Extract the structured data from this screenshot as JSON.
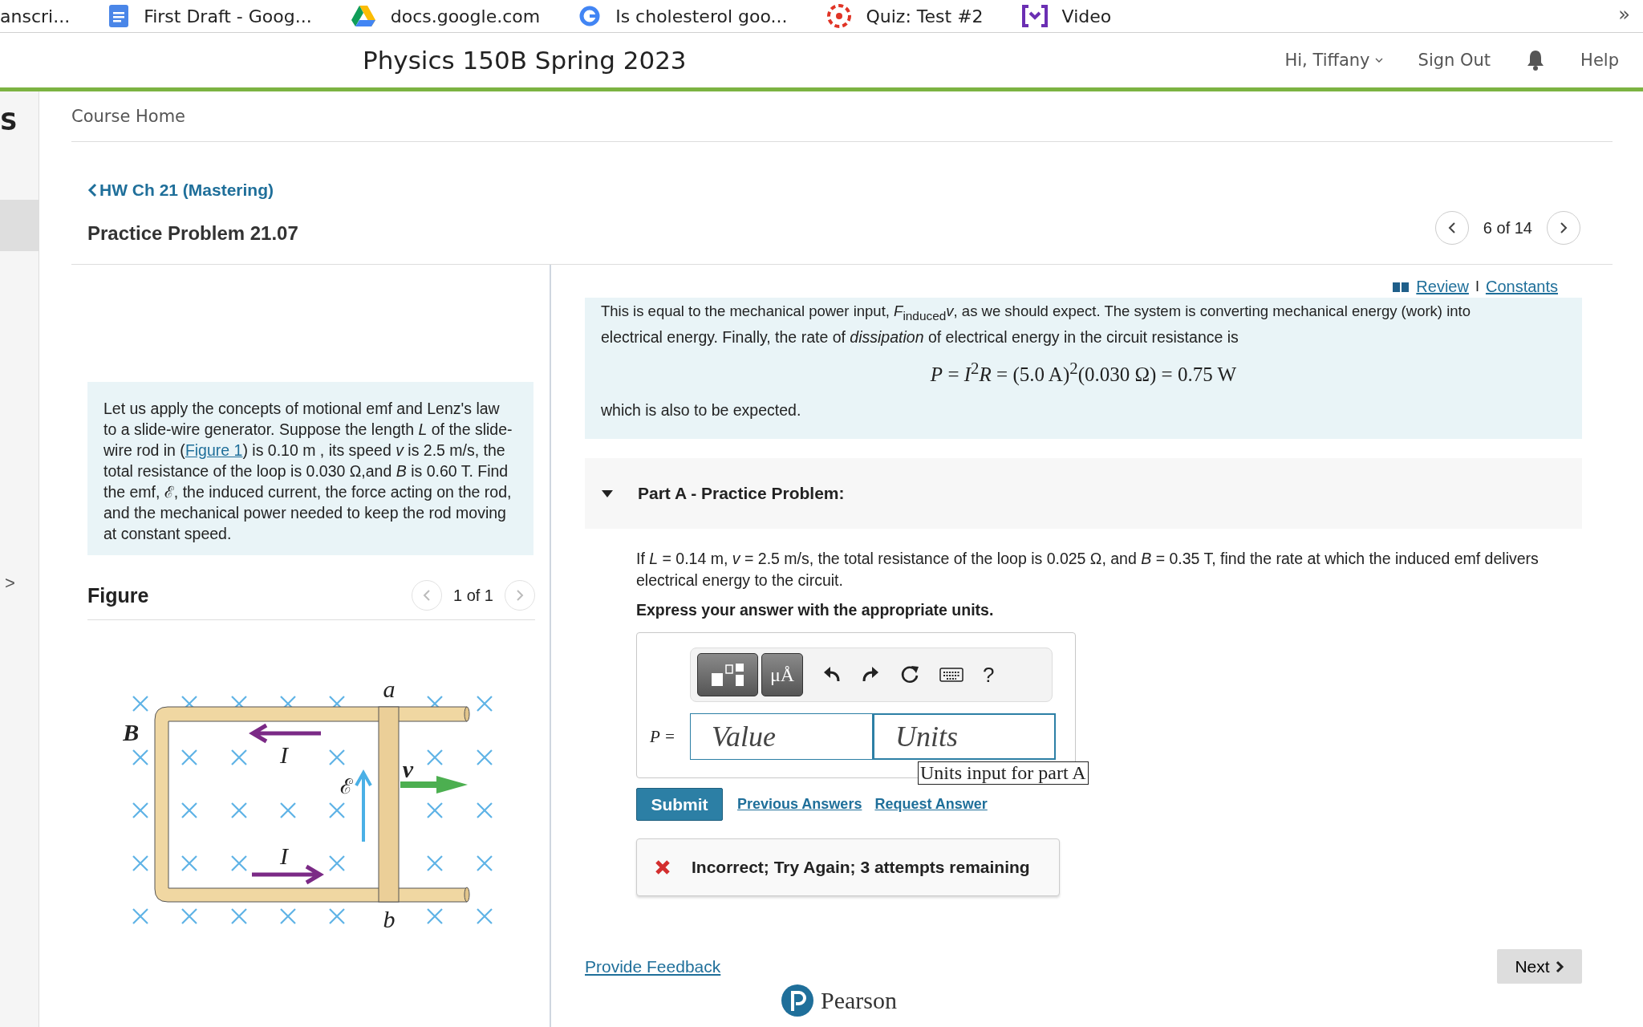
{
  "browser_tabs": [
    {
      "title": "anscri..."
    },
    {
      "title": "First Draft - Goog..."
    },
    {
      "title": "docs.google.com"
    },
    {
      "title": "Is cholesterol goo..."
    },
    {
      "title": "Quiz: Test #2"
    },
    {
      "title": "Video"
    }
  ],
  "browser_more": "»",
  "header": {
    "course_title": "Physics 150B Spring 2023",
    "greeting": "Hi, Tiffany",
    "sign_out": "Sign Out",
    "help": "Help"
  },
  "sidebar": {
    "letter": "S",
    "expand": ">"
  },
  "breadcrumb": "Course Home",
  "assignment_link": "HW Ch 21 (Mastering)",
  "problem_title": "Practice Problem 21.07",
  "pager": "6 of 14",
  "intro": {
    "before": "Let us apply the concepts of motional emf and Lenz's law to a slide-wire generator. Suppose the length *L* of the slide-wire rod in (",
    "link": "Figure 1",
    "after": ") is 0.10  m , its speed *v* is 2.5 m/s, the total resistance of the loop is 0.030 Ω,and *B* is 0.60 T. Find the emf, ℰ, the induced current, the force acting on the rod, and the mechanical power needed to keep the rod moving at constant speed."
  },
  "figure": {
    "title": "Figure",
    "pager": "1 of 1",
    "labels": {
      "a": "a",
      "b": "b",
      "i_top": "I",
      "i_bottom": "I",
      "emf": "ℰ",
      "v": "v⃗",
      "B": "B⃗"
    }
  },
  "links": {
    "review": "Review",
    "separator": "I",
    "constants": "Constants"
  },
  "explanation": {
    "cut_line": "This is equal to the mechanical power input, *F*$_{induced}$*v*, as we should expect. The system is converting mechanical energy (work) into",
    "line": "electrical energy. Finally, the rate of *dissipation* of electrical energy in the circuit resistance is",
    "equation": "*P* = *I*$^{2}$*R* = (5.0 A)$^{2}$(0.030 Ω) = 0.75 W",
    "closing": "which is also to be expected."
  },
  "part": {
    "title": "Part A - Practice Problem:",
    "expanded": true,
    "question": "If *L* = 0.14 m, *v* = 2.5 m/s, the total resistance of the loop is 0.025 Ω, and *B* = 0.35 T, find the rate at which the induced emf delivers electrical energy to the circuit.",
    "instruction": "Express your answer with the appropriate units.",
    "toolbar": {
      "units_label": "μÅ",
      "help": "?"
    },
    "variable": "P =",
    "value_placeholder": "Value",
    "units_placeholder": "Units",
    "tooltip": "Units input for part A",
    "submit": "Submit",
    "previous": "Previous Answers",
    "request": "Request Answer",
    "feedback": {
      "kind": "incorrect",
      "text": "Incorrect; Try Again; 3 attempts remaining"
    }
  },
  "provide_feedback": "Provide Feedback",
  "next": "Next",
  "footer_logo": "Pearson"
}
